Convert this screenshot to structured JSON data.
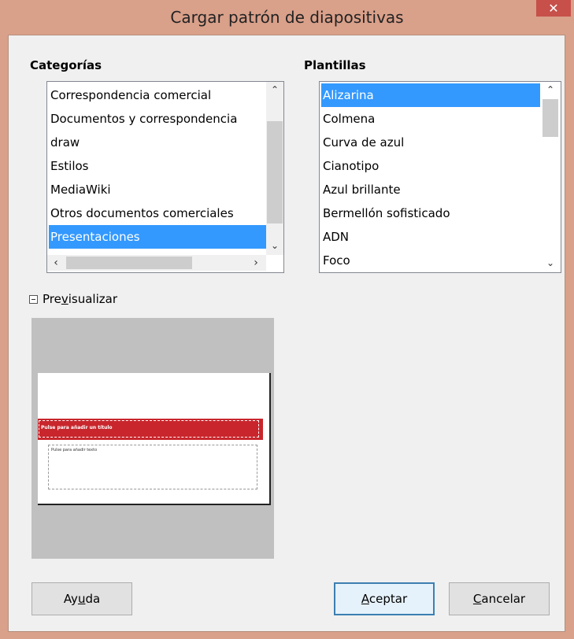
{
  "window": {
    "title": "Cargar patrón de diapositivas",
    "close_glyph": "✕"
  },
  "categories": {
    "label": "Categorías",
    "items": [
      "Correspondencia comercial",
      "Documentos y correspondencia",
      "draw",
      "Estilos",
      "MediaWiki",
      "Otros documentos comerciales",
      "Presentaciones"
    ],
    "selected": "Presentaciones"
  },
  "templates": {
    "label": "Plantillas",
    "items": [
      "Alizarina",
      "Colmena",
      "Curva de azul",
      "Cianotipo",
      "Azul brillante",
      "Bermellón sofisticado",
      "ADN",
      "Foco"
    ],
    "selected": "Alizarina"
  },
  "preview": {
    "toggle_pre": "Pre",
    "toggle_ul": "v",
    "toggle_post": "isualizar",
    "slide_title": "Pulse para añadir un título",
    "slide_body": "Pulse para añadir texto"
  },
  "buttons": {
    "help_pre": "Ay",
    "help_ul": "u",
    "help_post": "da",
    "ok_ul": "A",
    "ok_post": "ceptar",
    "cancel_ul": "C",
    "cancel_post": "ancelar"
  },
  "colors": {
    "selection": "#3399ff",
    "title_bar": "#d9a08a",
    "close_button": "#c7504a",
    "slide_band": "#c8262c"
  }
}
